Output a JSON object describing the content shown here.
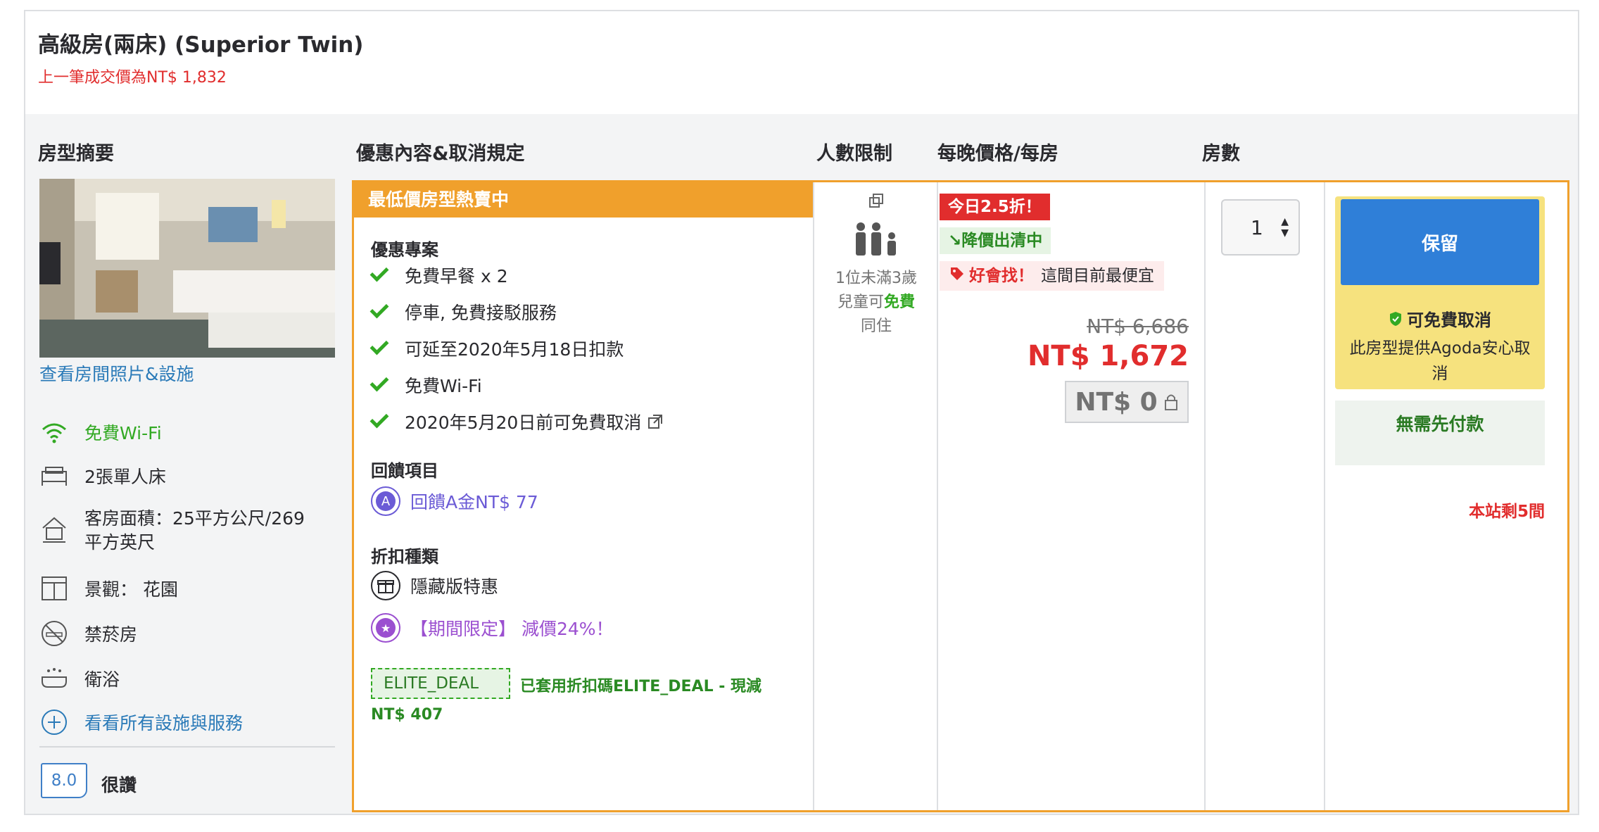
{
  "room": {
    "title": "高級房(兩床) (Superior Twin)",
    "last_price": "上一筆成交價為NT$ 1,832"
  },
  "headers": {
    "summary": "房型摘要",
    "offers": "優惠內容&取消規定",
    "occupancy": "人數限制",
    "price": "每晚價格/每房",
    "rooms": "房數"
  },
  "summary": {
    "photo_link": "查看房間照片&設施",
    "features": [
      {
        "icon": "wifi-icon",
        "label": "免費Wi-Fi"
      },
      {
        "icon": "bed-icon",
        "label": "2張單人床"
      },
      {
        "icon": "house-icon",
        "label": "客房面積：25平方公尺/269 平方英尺"
      },
      {
        "icon": "window-icon",
        "label": "景觀： 花園"
      },
      {
        "icon": "no-smoking-icon",
        "label": "禁菸房"
      },
      {
        "icon": "bathtub-icon",
        "label": "衛浴"
      },
      {
        "icon": "plus-circle-icon",
        "label": "看看所有設施與服務"
      }
    ],
    "score": "8.0",
    "score_text": "很讚"
  },
  "offer": {
    "banner": "最低價房型熱賣中",
    "deals_title": "優惠專案",
    "benefits": [
      "免費早餐 x 2",
      "停車, 免費接駁服務",
      "可延至2020年5月18日扣款",
      "免費Wi-Fi",
      "2020年5月20日前可免費取消"
    ],
    "reward_title": "回饋項目",
    "reward": "回饋A金NT$ 77",
    "reward_icon_text": "A",
    "discount_title": "折扣種類",
    "hidden_deal": "隱藏版特惠",
    "limited": "【期間限定】 減價24%！",
    "coupon_code": "ELITE_DEAL",
    "coupon_text": "已套用折扣碼ELITE_DEAL - 現減",
    "coupon_amount": "NT$ 407"
  },
  "occupancy": {
    "line1": "1位未滿3歲",
    "line2a": "兒童可",
    "line2b": "免費",
    "line3": "同住"
  },
  "price": {
    "badge_discount": "今日2.5折！",
    "badge_drop": "↘降價出清中",
    "badge_find": "好會找！",
    "badge_find_sub": "這間目前最便宜",
    "old": "NT$ 6,686",
    "new": "NT$ 1,672",
    "pay_now": "NT$ 0"
  },
  "rooms": {
    "selected": "1"
  },
  "book": {
    "button": "保留",
    "cancel_title": "可免費取消",
    "cancel_sub": "此房型提供Agoda安心取消",
    "no_prepay": "無需先付款",
    "remaining": "本站剩5間"
  },
  "colors": {
    "orange": "#f0a02c",
    "red": "#e12d2d",
    "green": "#32a923",
    "blue": "#2f7fd8",
    "yellow": "#f6e27e"
  }
}
